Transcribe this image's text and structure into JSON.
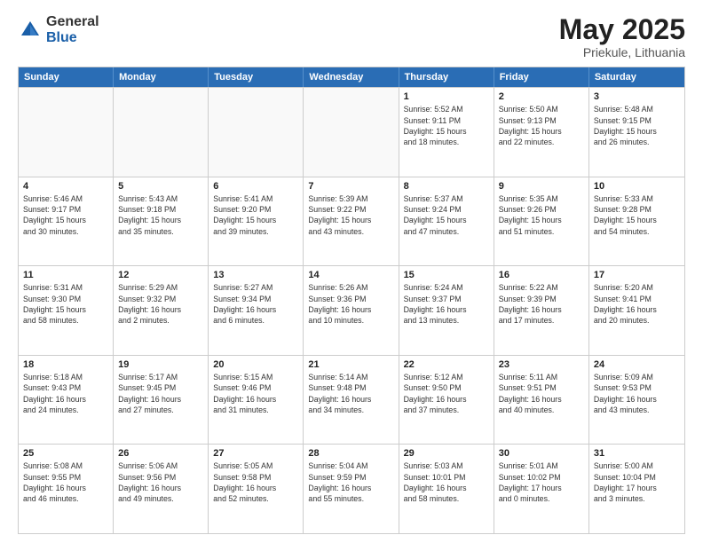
{
  "header": {
    "logo_general": "General",
    "logo_blue": "Blue",
    "month_title": "May 2025",
    "location": "Priekule, Lithuania"
  },
  "calendar": {
    "days_of_week": [
      "Sunday",
      "Monday",
      "Tuesday",
      "Wednesday",
      "Thursday",
      "Friday",
      "Saturday"
    ],
    "rows": [
      [
        {
          "day": "",
          "info": "",
          "empty": true
        },
        {
          "day": "",
          "info": "",
          "empty": true
        },
        {
          "day": "",
          "info": "",
          "empty": true
        },
        {
          "day": "",
          "info": "",
          "empty": true
        },
        {
          "day": "1",
          "info": "Sunrise: 5:52 AM\nSunset: 9:11 PM\nDaylight: 15 hours\nand 18 minutes."
        },
        {
          "day": "2",
          "info": "Sunrise: 5:50 AM\nSunset: 9:13 PM\nDaylight: 15 hours\nand 22 minutes."
        },
        {
          "day": "3",
          "info": "Sunrise: 5:48 AM\nSunset: 9:15 PM\nDaylight: 15 hours\nand 26 minutes."
        }
      ],
      [
        {
          "day": "4",
          "info": "Sunrise: 5:46 AM\nSunset: 9:17 PM\nDaylight: 15 hours\nand 30 minutes."
        },
        {
          "day": "5",
          "info": "Sunrise: 5:43 AM\nSunset: 9:18 PM\nDaylight: 15 hours\nand 35 minutes."
        },
        {
          "day": "6",
          "info": "Sunrise: 5:41 AM\nSunset: 9:20 PM\nDaylight: 15 hours\nand 39 minutes."
        },
        {
          "day": "7",
          "info": "Sunrise: 5:39 AM\nSunset: 9:22 PM\nDaylight: 15 hours\nand 43 minutes."
        },
        {
          "day": "8",
          "info": "Sunrise: 5:37 AM\nSunset: 9:24 PM\nDaylight: 15 hours\nand 47 minutes."
        },
        {
          "day": "9",
          "info": "Sunrise: 5:35 AM\nSunset: 9:26 PM\nDaylight: 15 hours\nand 51 minutes."
        },
        {
          "day": "10",
          "info": "Sunrise: 5:33 AM\nSunset: 9:28 PM\nDaylight: 15 hours\nand 54 minutes."
        }
      ],
      [
        {
          "day": "11",
          "info": "Sunrise: 5:31 AM\nSunset: 9:30 PM\nDaylight: 15 hours\nand 58 minutes."
        },
        {
          "day": "12",
          "info": "Sunrise: 5:29 AM\nSunset: 9:32 PM\nDaylight: 16 hours\nand 2 minutes."
        },
        {
          "day": "13",
          "info": "Sunrise: 5:27 AM\nSunset: 9:34 PM\nDaylight: 16 hours\nand 6 minutes."
        },
        {
          "day": "14",
          "info": "Sunrise: 5:26 AM\nSunset: 9:36 PM\nDaylight: 16 hours\nand 10 minutes."
        },
        {
          "day": "15",
          "info": "Sunrise: 5:24 AM\nSunset: 9:37 PM\nDaylight: 16 hours\nand 13 minutes."
        },
        {
          "day": "16",
          "info": "Sunrise: 5:22 AM\nSunset: 9:39 PM\nDaylight: 16 hours\nand 17 minutes."
        },
        {
          "day": "17",
          "info": "Sunrise: 5:20 AM\nSunset: 9:41 PM\nDaylight: 16 hours\nand 20 minutes."
        }
      ],
      [
        {
          "day": "18",
          "info": "Sunrise: 5:18 AM\nSunset: 9:43 PM\nDaylight: 16 hours\nand 24 minutes."
        },
        {
          "day": "19",
          "info": "Sunrise: 5:17 AM\nSunset: 9:45 PM\nDaylight: 16 hours\nand 27 minutes."
        },
        {
          "day": "20",
          "info": "Sunrise: 5:15 AM\nSunset: 9:46 PM\nDaylight: 16 hours\nand 31 minutes."
        },
        {
          "day": "21",
          "info": "Sunrise: 5:14 AM\nSunset: 9:48 PM\nDaylight: 16 hours\nand 34 minutes."
        },
        {
          "day": "22",
          "info": "Sunrise: 5:12 AM\nSunset: 9:50 PM\nDaylight: 16 hours\nand 37 minutes."
        },
        {
          "day": "23",
          "info": "Sunrise: 5:11 AM\nSunset: 9:51 PM\nDaylight: 16 hours\nand 40 minutes."
        },
        {
          "day": "24",
          "info": "Sunrise: 5:09 AM\nSunset: 9:53 PM\nDaylight: 16 hours\nand 43 minutes."
        }
      ],
      [
        {
          "day": "25",
          "info": "Sunrise: 5:08 AM\nSunset: 9:55 PM\nDaylight: 16 hours\nand 46 minutes."
        },
        {
          "day": "26",
          "info": "Sunrise: 5:06 AM\nSunset: 9:56 PM\nDaylight: 16 hours\nand 49 minutes."
        },
        {
          "day": "27",
          "info": "Sunrise: 5:05 AM\nSunset: 9:58 PM\nDaylight: 16 hours\nand 52 minutes."
        },
        {
          "day": "28",
          "info": "Sunrise: 5:04 AM\nSunset: 9:59 PM\nDaylight: 16 hours\nand 55 minutes."
        },
        {
          "day": "29",
          "info": "Sunrise: 5:03 AM\nSunset: 10:01 PM\nDaylight: 16 hours\nand 58 minutes."
        },
        {
          "day": "30",
          "info": "Sunrise: 5:01 AM\nSunset: 10:02 PM\nDaylight: 17 hours\nand 0 minutes."
        },
        {
          "day": "31",
          "info": "Sunrise: 5:00 AM\nSunset: 10:04 PM\nDaylight: 17 hours\nand 3 minutes."
        }
      ]
    ]
  }
}
